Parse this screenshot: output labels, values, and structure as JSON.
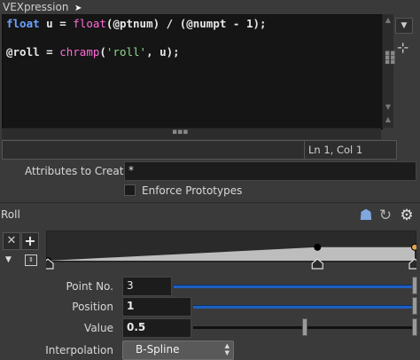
{
  "vex": {
    "label": "VEXpression",
    "line1": {
      "kw": "float",
      "var": " u",
      "eq": " = ",
      "fn": "float",
      "rest": "(@ptnum) / (@numpt - 1);"
    },
    "line2": {
      "var": "@roll",
      "eq": " = ",
      "fn": "chramp",
      "open": "(",
      "str": "'roll'",
      "rest": ", u);"
    },
    "status": "Ln 1, Col 1"
  },
  "attributes": {
    "label": "Attributes to Create",
    "value": "*"
  },
  "enforce": {
    "label": "Enforce Prototypes",
    "checked": false
  },
  "roll": {
    "label": "Roll",
    "point_no": {
      "label": "Point No.",
      "value": "3"
    },
    "position": {
      "label": "Position",
      "value": "1"
    },
    "value": {
      "label": "Value",
      "value": "0.5"
    },
    "interpolation": {
      "label": "Interpolation",
      "value": "B-Spline"
    },
    "ramp_points": [
      {
        "pos": 0,
        "value": 0
      },
      {
        "pos": 0.735,
        "value": 0.5
      },
      {
        "pos": 1,
        "value": 0.5
      }
    ],
    "slider_fractions": {
      "point_no": 1.0,
      "position": 1.0,
      "value": 0.5
    }
  },
  "icons": [
    "dropdown-arrow-icon",
    "snippet-icon",
    "preset-icon",
    "reset-icon",
    "gear-icon",
    "collapse-icon",
    "expand-icon"
  ]
}
